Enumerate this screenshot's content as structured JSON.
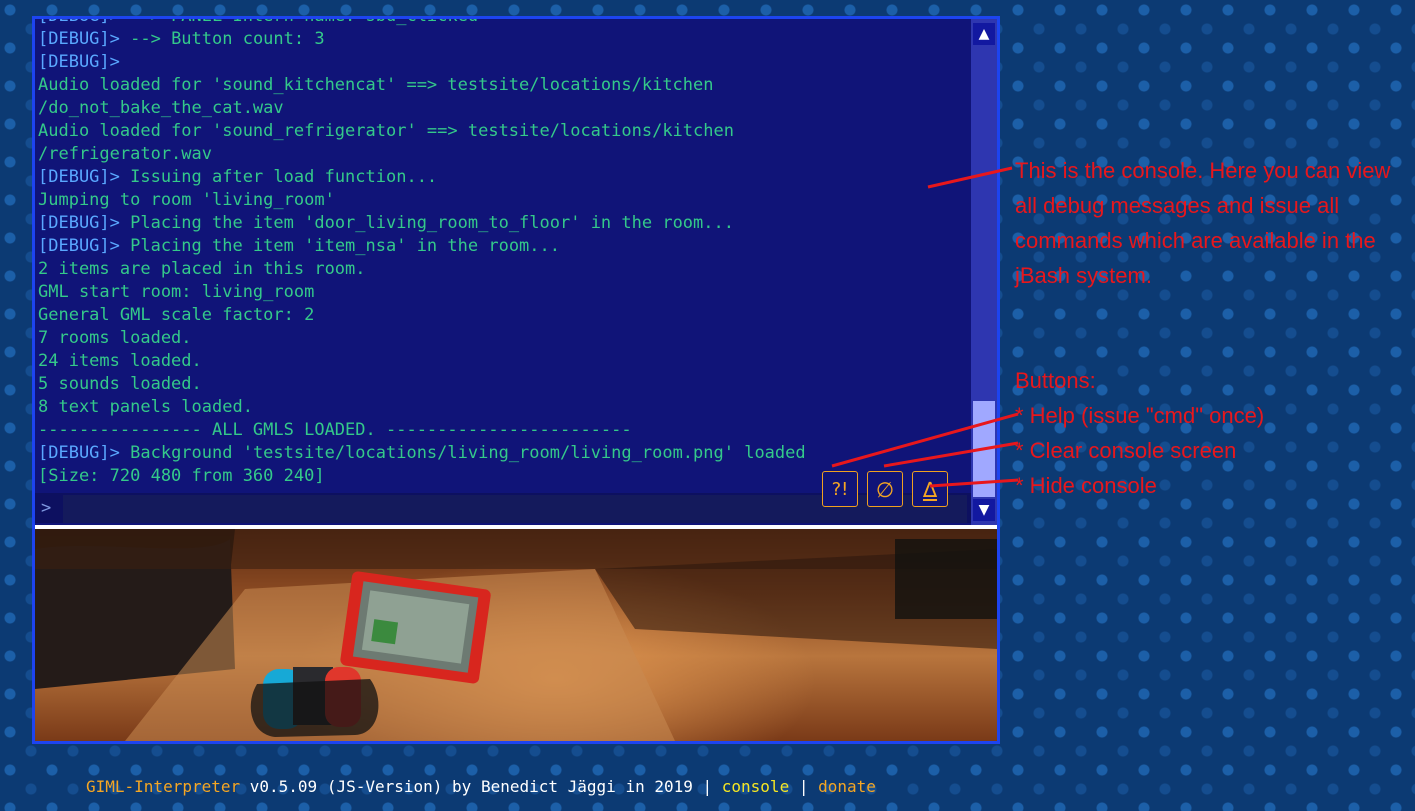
{
  "console": {
    "log": [
      {
        "prefix": "[DEBUG]>",
        "text": " --> PANEL Intern name: sbd_clicked"
      },
      {
        "prefix": "[DEBUG]>",
        "text": " --> Button count: 3"
      },
      {
        "prefix": "[DEBUG]>",
        "text": ""
      },
      {
        "prefix": "",
        "text": "Audio loaded for 'sound_kitchencat' ==> testsite/locations/kitchen"
      },
      {
        "prefix": "",
        "text": "/do_not_bake_the_cat.wav"
      },
      {
        "prefix": "",
        "text": "Audio loaded for 'sound_refrigerator' ==> testsite/locations/kitchen"
      },
      {
        "prefix": "",
        "text": "/refrigerator.wav"
      },
      {
        "prefix": "[DEBUG]>",
        "text": " Issuing after load function..."
      },
      {
        "prefix": "",
        "text": "Jumping to room 'living_room'"
      },
      {
        "prefix": "[DEBUG]>",
        "text": " Placing the item 'door_living_room_to_floor' in the room..."
      },
      {
        "prefix": "[DEBUG]>",
        "text": " Placing the item 'item_nsa' in the room..."
      },
      {
        "prefix": "",
        "text": "2 items are placed in this room."
      },
      {
        "prefix": "",
        "text": "GML start room: living_room"
      },
      {
        "prefix": "",
        "text": "General GML scale factor: 2"
      },
      {
        "prefix": "",
        "text": "7 rooms loaded."
      },
      {
        "prefix": "",
        "text": "24 items loaded."
      },
      {
        "prefix": "",
        "text": "5 sounds loaded."
      },
      {
        "prefix": "",
        "text": "8 text panels loaded."
      },
      {
        "prefix": "",
        "text": "---------------- ALL GMLS LOADED. ------------------------"
      },
      {
        "prefix": "[DEBUG]>",
        "text": " Background 'testsite/locations/living_room/living_room.png' loaded"
      },
      {
        "prefix": "",
        "text": "[Size: 720 480 from 360 240]"
      }
    ],
    "prompt": ">",
    "input_value": "",
    "buttons": {
      "help": "?!",
      "clear": "∅",
      "hide": "∆"
    },
    "scroll_up": "▲",
    "scroll_down": "▼"
  },
  "annotation": {
    "text": "This is the console. Here you can view all debug messages and issue all commands which are available in the jBash system.",
    "buttons_title": "Buttons:",
    "buttons": [
      "* Help (issue \"cmd\" once)",
      "* Clear console screen",
      "* Hide console"
    ]
  },
  "footer": {
    "app_name": "GIML-Interpreter",
    "version_text": " v0.5.09 (JS-Version) by Benedict Jäggi in 2019 | ",
    "console_link": "console",
    "separator": " | ",
    "donate_link": "donate"
  }
}
